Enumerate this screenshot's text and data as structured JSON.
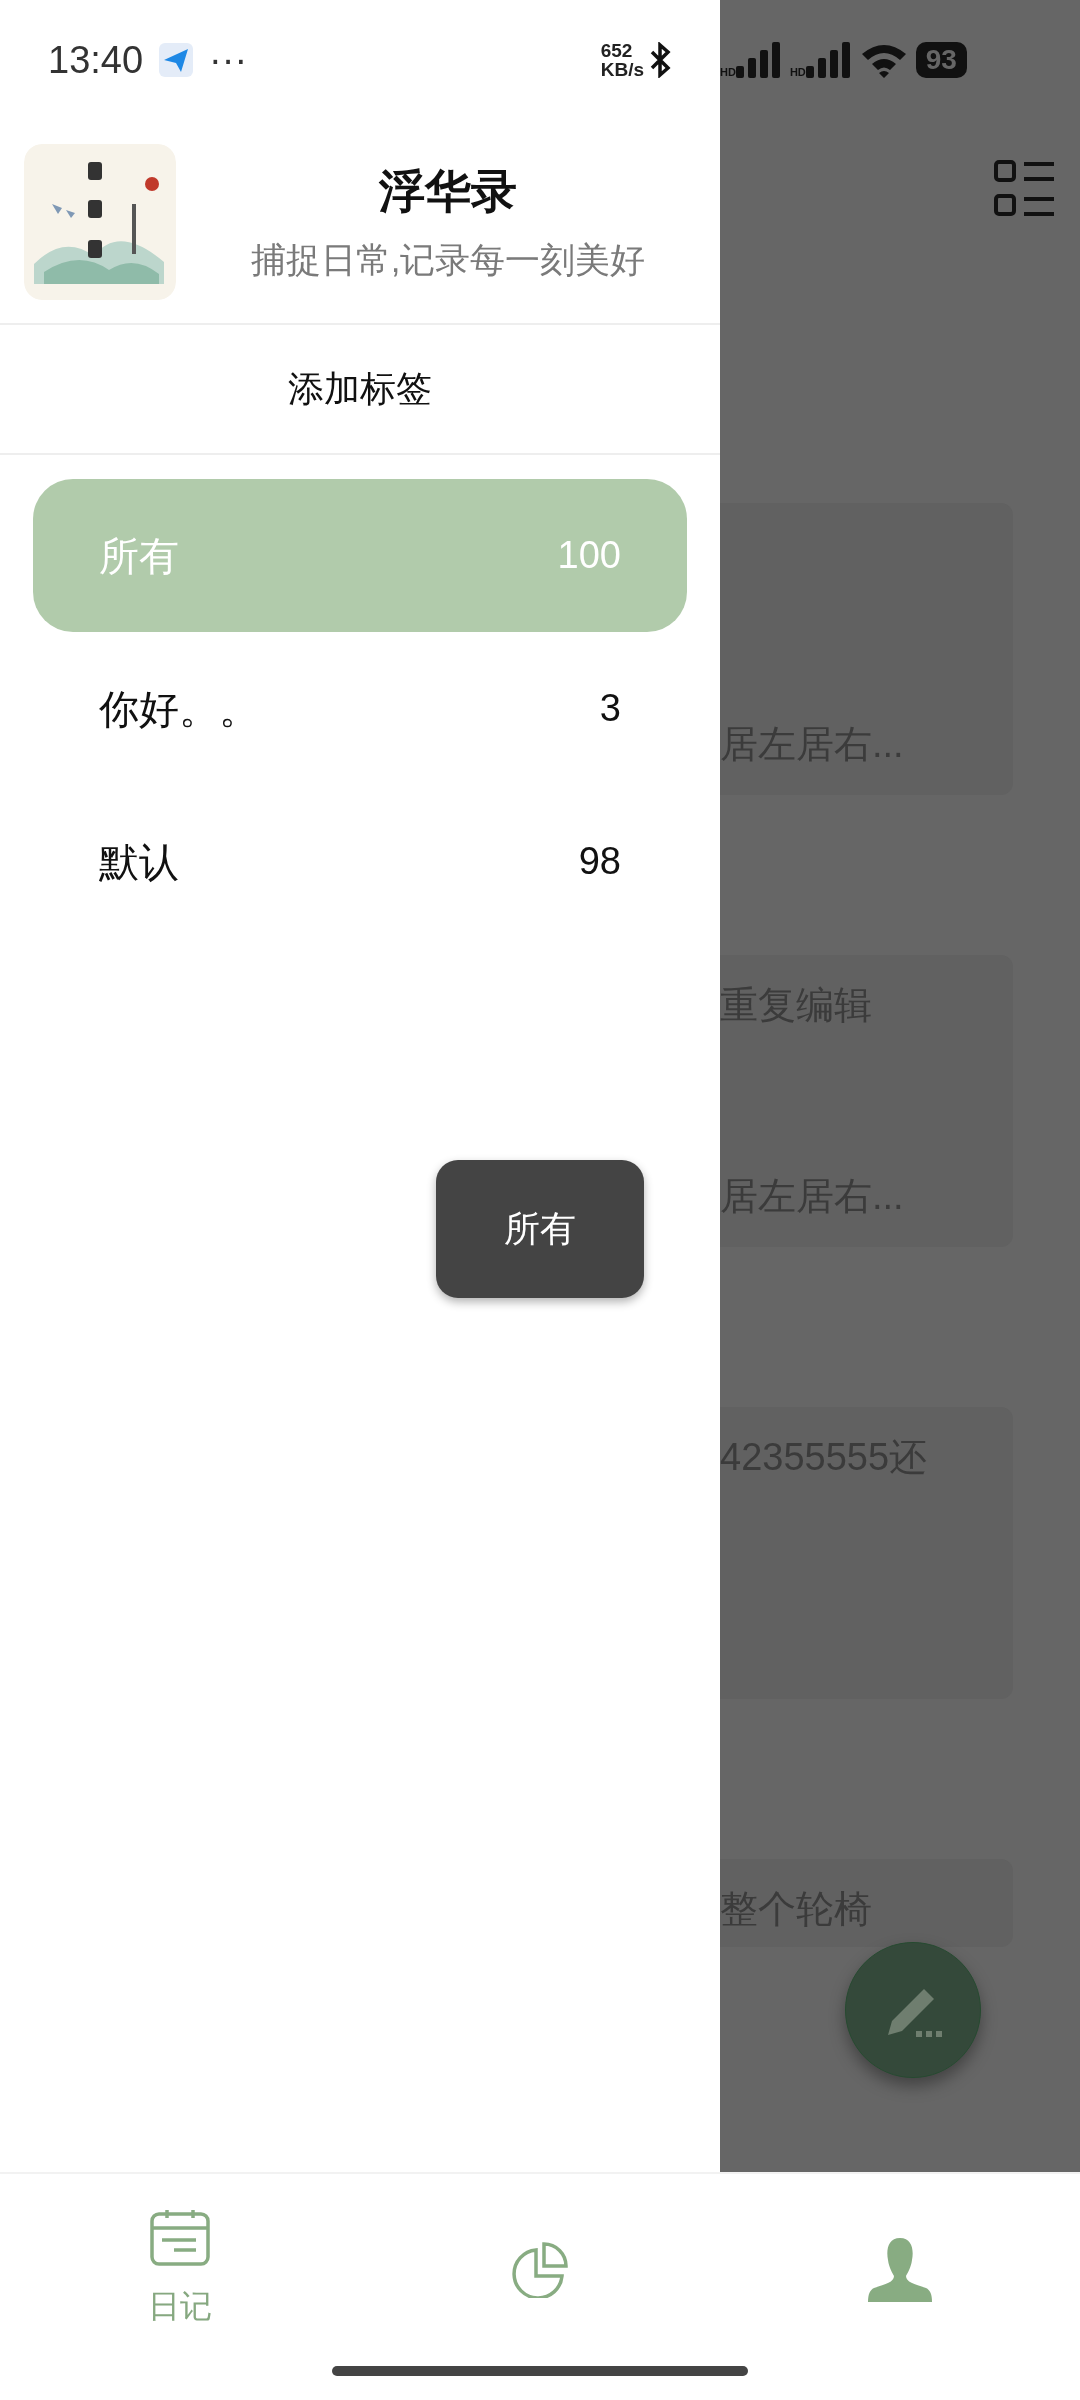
{
  "status_bar": {
    "time": "13:40",
    "more": "···",
    "net_speed": "652",
    "net_unit": "KB/s",
    "signal_labels": [
      "HD",
      "HD"
    ],
    "battery": "93"
  },
  "drawer": {
    "app_name": "浮华录",
    "slogan": "捕捉日常,记录每一刻美好",
    "add_tag": "添加标签",
    "tags": [
      {
        "name": "所有",
        "count": "100",
        "selected": true
      },
      {
        "name": "你好。。",
        "count": "3",
        "selected": false
      },
      {
        "name": "默认",
        "count": "98",
        "selected": false
      }
    ]
  },
  "background": {
    "cards": [
      {
        "kind": "tall",
        "bottom": "居左居右..."
      },
      {
        "kind": "tall",
        "top": "重复编辑",
        "bottom": "居左居右..."
      },
      {
        "kind": "tall",
        "top": "42355555还"
      },
      {
        "kind": "short",
        "top": "整个轮椅"
      }
    ]
  },
  "toast": "所有",
  "bottom_nav": [
    {
      "kind": "calendar",
      "label": "日记"
    },
    {
      "kind": "chart"
    },
    {
      "kind": "person"
    }
  ]
}
